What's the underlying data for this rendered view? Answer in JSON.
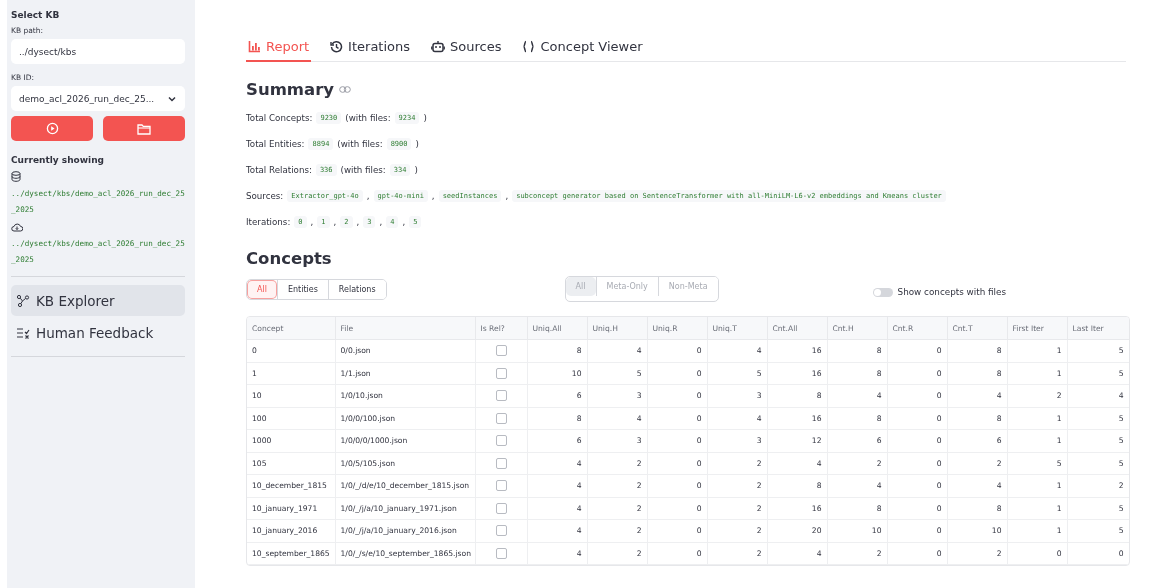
{
  "sidebar": {
    "select_title": "Select KB",
    "kb_path_label": "KB path:",
    "kb_path_value": "../dysect/kbs",
    "kb_id_label": "KB ID:",
    "kb_id_value": "demo_acl_2026_run_dec_25...",
    "showing_title": "Currently showing",
    "paths": [
      {
        "kind": "database",
        "value": "../dysect/kbs/demo_acl_2026_run_dec_25_2025"
      },
      {
        "kind": "cloud",
        "value": "../dysect/kbs/demo_acl_2026_run_dec_25_2025"
      }
    ],
    "nav": [
      {
        "label": "KB Explorer",
        "kind": "graph",
        "selected": true
      },
      {
        "label": "Human Feedback",
        "kind": "checklist",
        "selected": false
      }
    ]
  },
  "tabs": [
    {
      "label": "Report",
      "kind": "chart",
      "selected": true
    },
    {
      "label": "Iterations",
      "kind": "history",
      "selected": false
    },
    {
      "label": "Sources",
      "kind": "robot",
      "selected": false
    },
    {
      "label": "Concept Viewer",
      "kind": "braces",
      "selected": false
    }
  ],
  "summary": {
    "title": "Summary",
    "lines": [
      [
        {
          "kind": "text",
          "text": "Total Concepts:"
        },
        {
          "kind": "code",
          "text": "9230"
        },
        {
          "kind": "text",
          "text": "(with files:"
        },
        {
          "kind": "code",
          "text": "9234"
        },
        {
          "kind": "text",
          "text": ")"
        }
      ],
      [
        {
          "kind": "text",
          "text": "Total Entities:"
        },
        {
          "kind": "code",
          "text": "8894"
        },
        {
          "kind": "text",
          "text": "(with files:"
        },
        {
          "kind": "code",
          "text": "8900"
        },
        {
          "kind": "text",
          "text": ")"
        }
      ],
      [
        {
          "kind": "text",
          "text": "Total Relations:"
        },
        {
          "kind": "code",
          "text": "336"
        },
        {
          "kind": "text",
          "text": "(with files:"
        },
        {
          "kind": "code",
          "text": "334"
        },
        {
          "kind": "text",
          "text": ")"
        }
      ],
      [
        {
          "kind": "text",
          "text": "Sources:"
        },
        {
          "kind": "code",
          "text": "Extractor_gpt-4o"
        },
        {
          "kind": "text",
          "text": ","
        },
        {
          "kind": "code",
          "text": "gpt-4o-mini"
        },
        {
          "kind": "text",
          "text": ","
        },
        {
          "kind": "code",
          "text": "seedInstances"
        },
        {
          "kind": "text",
          "text": ","
        },
        {
          "kind": "code",
          "text": "subconcept generator based on SentenceTransformer with all-MiniLM-L6-v2 embeddings and Kmeans cluster"
        }
      ],
      [
        {
          "kind": "text",
          "text": "Iterations:"
        },
        {
          "kind": "code",
          "text": "0"
        },
        {
          "kind": "text",
          "text": ","
        },
        {
          "kind": "code",
          "text": "1"
        },
        {
          "kind": "text",
          "text": ","
        },
        {
          "kind": "code",
          "text": "2"
        },
        {
          "kind": "text",
          "text": ","
        },
        {
          "kind": "code",
          "text": "3"
        },
        {
          "kind": "text",
          "text": ","
        },
        {
          "kind": "code",
          "text": "4"
        },
        {
          "kind": "text",
          "text": ","
        },
        {
          "kind": "code",
          "text": "5"
        }
      ]
    ]
  },
  "concepts": {
    "title": "Concepts",
    "type_filter": [
      {
        "label": "All",
        "selected": true
      },
      {
        "label": "Entities",
        "selected": false
      },
      {
        "label": "Relations",
        "selected": false
      }
    ],
    "meta_filter": {
      "disabled": true,
      "options": [
        {
          "label": "All",
          "selected": true
        },
        {
          "label": "Meta-Only",
          "selected": false
        },
        {
          "label": "Non-Meta",
          "selected": false
        }
      ]
    },
    "toggle": {
      "label": "Show concepts with files",
      "on": false
    },
    "columns": [
      "Concept",
      "File",
      "Is Rel?",
      "Uniq.All",
      "Uniq.H",
      "Uniq.R",
      "Uniq.T",
      "Cnt.All",
      "Cnt.H",
      "Cnt.R",
      "Cnt.T",
      "First Iter",
      "Last Iter"
    ],
    "rows": [
      {
        "concept": "0",
        "file": "0/0.json",
        "is_rel": false,
        "nums": [
          "8",
          "4",
          "0",
          "4",
          "16",
          "8",
          "0",
          "8",
          "1",
          "5"
        ]
      },
      {
        "concept": "1",
        "file": "1/1.json",
        "is_rel": false,
        "nums": [
          "10",
          "5",
          "0",
          "5",
          "16",
          "8",
          "0",
          "8",
          "1",
          "5"
        ]
      },
      {
        "concept": "10",
        "file": "1/0/10.json",
        "is_rel": false,
        "nums": [
          "6",
          "3",
          "0",
          "3",
          "8",
          "4",
          "0",
          "4",
          "2",
          "4"
        ]
      },
      {
        "concept": "100",
        "file": "1/0/0/100.json",
        "is_rel": false,
        "nums": [
          "8",
          "4",
          "0",
          "4",
          "16",
          "8",
          "0",
          "8",
          "1",
          "5"
        ]
      },
      {
        "concept": "1000",
        "file": "1/0/0/0/1000.json",
        "is_rel": false,
        "nums": [
          "6",
          "3",
          "0",
          "3",
          "12",
          "6",
          "0",
          "6",
          "1",
          "5"
        ]
      },
      {
        "concept": "105",
        "file": "1/0/5/105.json",
        "is_rel": false,
        "nums": [
          "4",
          "2",
          "0",
          "2",
          "4",
          "2",
          "0",
          "2",
          "5",
          "5"
        ]
      },
      {
        "concept": "10_december_1815",
        "file": "1/0/_/d/e/10_december_1815.json",
        "is_rel": false,
        "nums": [
          "4",
          "2",
          "0",
          "2",
          "8",
          "4",
          "0",
          "4",
          "1",
          "2"
        ]
      },
      {
        "concept": "10_january_1971",
        "file": "1/0/_/j/a/10_january_1971.json",
        "is_rel": false,
        "nums": [
          "4",
          "2",
          "0",
          "2",
          "16",
          "8",
          "0",
          "8",
          "1",
          "5"
        ]
      },
      {
        "concept": "10_january_2016",
        "file": "1/0/_/j/a/10_january_2016.json",
        "is_rel": false,
        "nums": [
          "4",
          "2",
          "0",
          "2",
          "20",
          "10",
          "0",
          "10",
          "1",
          "5"
        ]
      },
      {
        "concept": "10_september_1865",
        "file": "1/0/_/s/e/10_september_1865.json",
        "is_rel": false,
        "nums": [
          "4",
          "2",
          "0",
          "2",
          "4",
          "2",
          "0",
          "2",
          "0",
          "0"
        ]
      }
    ]
  }
}
